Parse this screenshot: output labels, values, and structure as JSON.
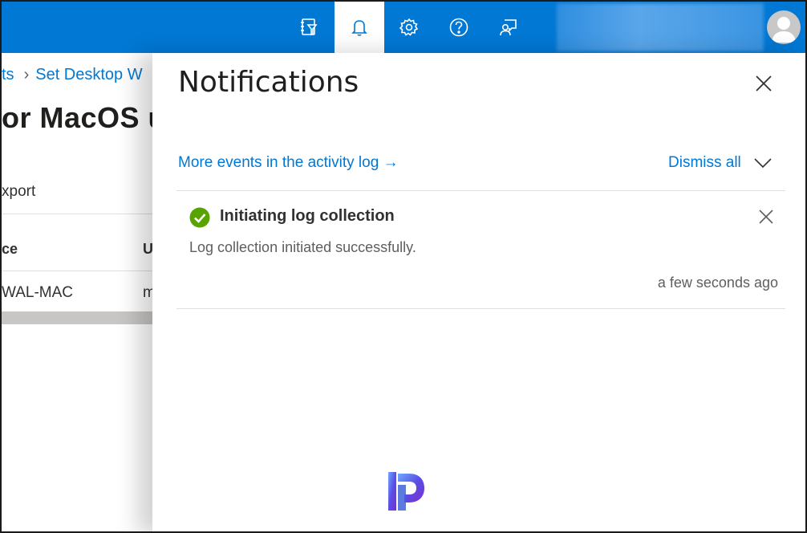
{
  "topbar": {
    "icons": [
      "feedback-filter-icon",
      "bell-icon",
      "gear-icon",
      "help-icon",
      "feedback-person-icon"
    ],
    "accent": "#0078d4"
  },
  "background_page": {
    "breadcrumb_prev": "ts",
    "breadcrumb_current": "Set Desktop W",
    "title": "or MacOS u",
    "export_label": "xport",
    "col1_header": "ce",
    "col2_header": "U",
    "row1_col1": "WAL-MAC",
    "row1_col2": "m"
  },
  "notifications": {
    "title": "Notifications",
    "activity_link": "More events in the activity log →",
    "dismiss_all": "Dismiss all",
    "items": [
      {
        "title": "Initiating log collection",
        "body": "Log collection initiated successfully.",
        "time": "a few seconds ago",
        "status_color": "#57a300"
      }
    ]
  }
}
